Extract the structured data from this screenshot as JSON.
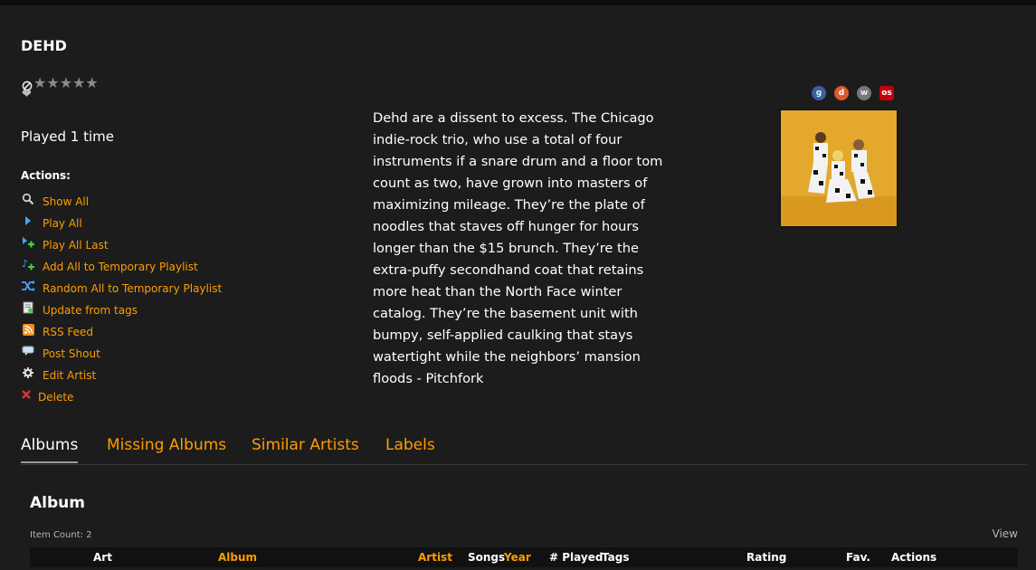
{
  "artist": {
    "name": "DEHD",
    "rating_stars": [
      "★",
      "★",
      "★",
      "★",
      "★"
    ],
    "played_text": "Played 1 time"
  },
  "actions": {
    "title": "Actions:",
    "items": [
      {
        "label": "Show All",
        "icon": "search-icon"
      },
      {
        "label": "Play All",
        "icon": "play-icon"
      },
      {
        "label": "Play All Last",
        "icon": "play-last-icon"
      },
      {
        "label": "Add All to Temporary Playlist",
        "icon": "add-to-playlist-icon"
      },
      {
        "label": "Random All to Temporary Playlist",
        "icon": "shuffle-icon"
      },
      {
        "label": "Update from tags",
        "icon": "update-tags-icon"
      },
      {
        "label": "RSS Feed",
        "icon": "rss-icon"
      },
      {
        "label": "Post Shout",
        "icon": "shout-icon"
      },
      {
        "label": "Edit Artist",
        "icon": "edit-icon"
      },
      {
        "label": "Delete",
        "icon": "delete-icon"
      }
    ]
  },
  "bio": "Dehd are a dissent to excess. The Chicago indie-rock trio, who use a total of four instruments if a snare drum and a floor tom count as two, have grown into masters of maximizing mileage. They’re the plate of noodles that staves off hunger for hours longer than the $15 brunch. They’re the extra-puffy secondhand coat that retains more heat than the North Face winter catalog. They’re the basement unit with bumpy, self-applied caulking that stays watertight while the neighbors’ mansion floods - Pitchfork",
  "external_links": [
    {
      "icon": "google-icon",
      "glyph": "g",
      "color": "#3d5da8"
    },
    {
      "icon": "duckduckgo-icon",
      "glyph": "d",
      "color": "#de5833"
    },
    {
      "icon": "wikipedia-icon",
      "glyph": "w",
      "color": "#777777"
    },
    {
      "icon": "lastfm-icon",
      "glyph": "os",
      "color": "#c3000d"
    }
  ],
  "tabs": [
    "Albums",
    "Missing Albums",
    "Similar Artists",
    "Labels"
  ],
  "albums_section": {
    "title": "Album",
    "item_count": "Item Count: 2",
    "view_label": "View",
    "columns": [
      "Art",
      "Album",
      "Artist",
      "Songs",
      "Year",
      "# Played",
      "Tags",
      "Rating",
      "Fav.",
      "Actions"
    ]
  },
  "colors": {
    "accent": "#ff9d00",
    "background": "#1c1c1c"
  }
}
